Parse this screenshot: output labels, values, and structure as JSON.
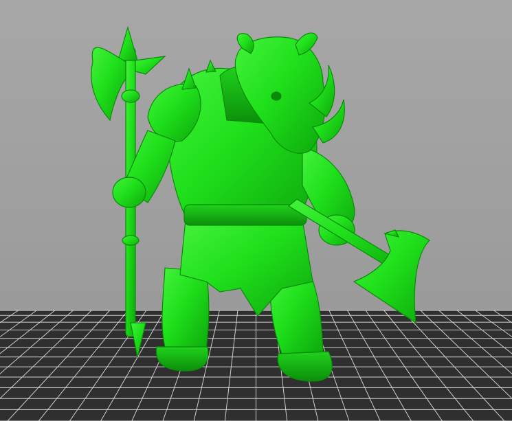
{
  "scene": {
    "background_color": "#9e9e9e",
    "bed_grid_color": "#2f2f2f",
    "bed_line_color": "#c8c8c8",
    "model_color": "#1fe01b",
    "model_highlight_color": "#5cff52",
    "model_shadow_color": "#0a9a0a",
    "model_icon": "rhino-warrior-miniature-icon"
  }
}
